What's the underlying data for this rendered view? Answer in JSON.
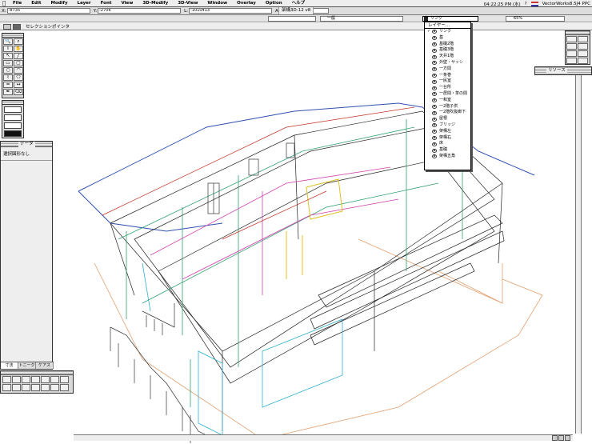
{
  "menubar": {
    "apple": "",
    "items": [
      "File",
      "Edit",
      "Modify",
      "Layer",
      "Font",
      "View",
      "3D-Modify",
      "3D-View",
      "Window",
      "Overlay",
      "Option",
      "ヘルプ"
    ],
    "clock": "04:22:25 PM (水)",
    "app_name": "VectorWorks8.5J4 PPC"
  },
  "statusbar": {
    "x_label": "X:",
    "x_value": "-8735",
    "y_label": "Y:",
    "y_value": "-2706",
    "l_label": "L:",
    "l_value": "-1010413",
    "a_label": "A:",
    "a_value": ""
  },
  "window": {
    "title": "架構3D-12 v8"
  },
  "toolbar2": {
    "class_value": "一般",
    "layer_value": "リンク",
    "zoom_value": "65%"
  },
  "modebar": {
    "hint": "セレクションポインタ"
  },
  "datapalette": {
    "title": "データ",
    "message": "選択図形なし",
    "tabs": [
      "寸法",
      "トニーク",
      "ケアス"
    ]
  },
  "resource": {
    "title": "リソース"
  },
  "layer_dropdown": {
    "header": "レイヤー...",
    "items": [
      {
        "label": "リンク",
        "checked": true
      },
      {
        "label": "基",
        "checked": false
      },
      {
        "label": "基礎2階",
        "checked": false
      },
      {
        "label": "基礎3階",
        "checked": false
      },
      {
        "label": "天井1階",
        "checked": false
      },
      {
        "label": "外壁・サッシ",
        "checked": false
      },
      {
        "label": "一方間",
        "checked": false
      },
      {
        "label": "一条巻",
        "checked": false
      },
      {
        "label": "一民室",
        "checked": false
      },
      {
        "label": "一台所",
        "checked": false
      },
      {
        "label": "一居間・茶の間",
        "checked": false
      },
      {
        "label": "一和室",
        "checked": false
      },
      {
        "label": "一2階子供",
        "checked": false
      },
      {
        "label": "一2階吹抜廊下",
        "checked": false
      },
      {
        "label": "屋根",
        "checked": false
      },
      {
        "label": "ブリッジ",
        "checked": false
      },
      {
        "label": "架構左",
        "checked": false
      },
      {
        "label": "架構右",
        "checked": false
      },
      {
        "label": "床",
        "checked": false
      },
      {
        "label": "基礎",
        "checked": false
      },
      {
        "label": "架構五角",
        "checked": false
      }
    ]
  },
  "colors": {
    "dropdown_border": "#000000",
    "menubar": "#eeeeee"
  }
}
